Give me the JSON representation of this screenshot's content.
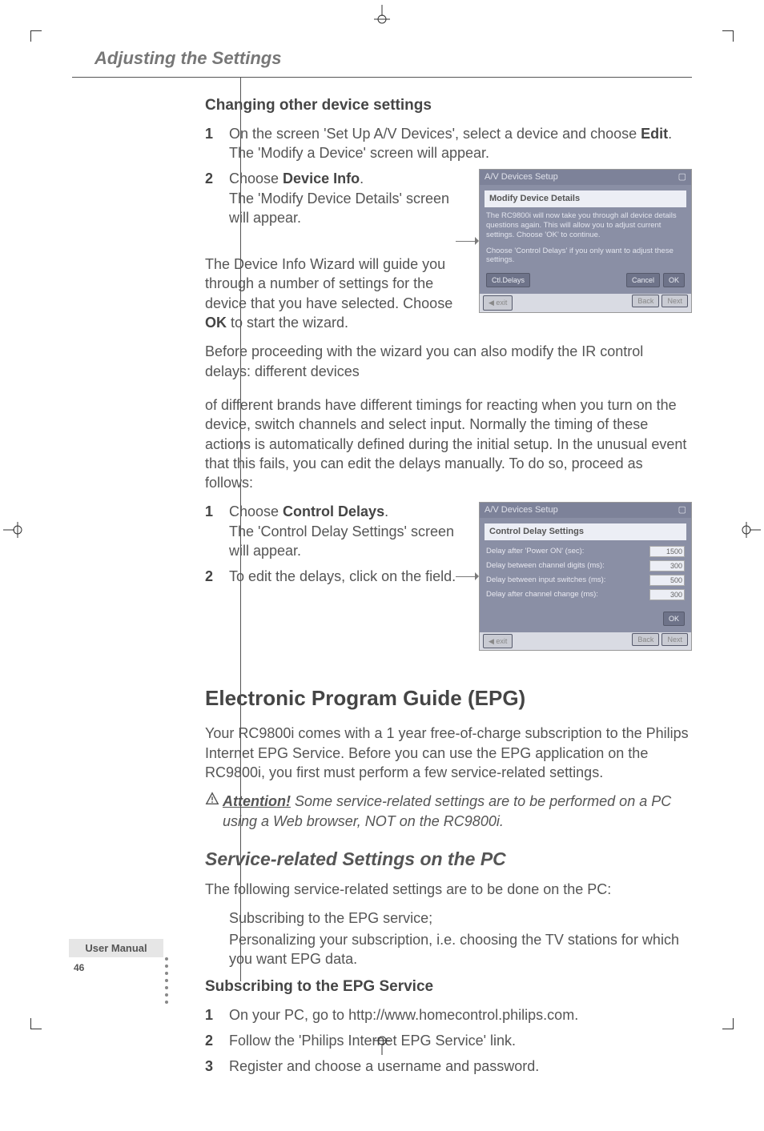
{
  "running_head": "Adjusting the Settings",
  "section1": {
    "title": "Changing other device settings",
    "step1_num": "1",
    "step1_a": "On the screen 'Set Up A/V Devices', select a device and choose ",
    "step1_bold": "Edit",
    "step1_b": ".",
    "step1_line2": "The 'Modify a Device' screen will appear.",
    "step2_num": "2",
    "step2_a": "Choose ",
    "step2_bold": "Device Info",
    "step2_b": ".",
    "step2_line2": "The 'Modify Device Details' screen will appear.",
    "para_wiz_a": "The Device Info Wizard will guide you through a number of settings for the device that you have selected. Choose ",
    "para_wiz_bold": "OK",
    "para_wiz_b": " to start the wizard.",
    "para_before": "Before proceeding with the wizard you can also modify the IR control delays: different devices",
    "para_brands": "of different brands have different timings for reacting when you turn on the device, switch channels and select input. Normally the timing of these actions is automatically defined during the initial setup. In the unusual event that this fails, you can edit the delays manually. To do so, proceed as follows:",
    "cd_step1_num": "1",
    "cd_step1_a": "Choose ",
    "cd_step1_bold": "Control Delays",
    "cd_step1_b": ".",
    "cd_step1_line2": "The 'Control Delay Settings' screen will appear.",
    "cd_step2_num": "2",
    "cd_step2_text": "To edit the delays, click on the field."
  },
  "screenshot1": {
    "titlebar": "A/V Devices Setup",
    "header": "Modify Device Details",
    "body1": "The RC9800i will now take you through all device details questions again. This will allow you to adjust current settings. Choose 'OK' to continue.",
    "body2": "Choose 'Control Delays' if you only want to adjust these settings.",
    "btn_delays": "Ctl.Delays",
    "btn_cancel": "Cancel",
    "btn_ok": "OK",
    "foot_left": "◀ exit",
    "foot_back": "Back",
    "foot_next": "Next"
  },
  "screenshot2": {
    "titlebar": "A/V Devices Setup",
    "header": "Control Delay Settings",
    "row1_label": "Delay after 'Power ON' (sec):",
    "row1_val": "1500",
    "row2_label": "Delay between channel digits (ms):",
    "row2_val": "300",
    "row3_label": "Delay between input switches (ms):",
    "row3_val": "500",
    "row4_label": "Delay after channel change (ms):",
    "row4_val": "300",
    "btn_ok": "OK",
    "foot_left": "◀ exit",
    "foot_back": "Back",
    "foot_next": "Next"
  },
  "epg": {
    "title": "Electronic Program Guide (EPG)",
    "intro": "Your RC9800i comes with a 1 year free-of-charge subscription to the Philips Internet EPG Service. Before you can use the EPG application on the RC9800i, you first must perform a few service-related settings.",
    "attn_label": "Attention!",
    "attn_text": " Some service-related settings are to be performed on a PC using a Web browser, NOT on the RC9800i.",
    "h3": "Service-related Settings on the PC",
    "para": "The following service-related settings are to be done on the PC:",
    "bullet1": "Subscribing to the EPG service;",
    "bullet2": "Personalizing your subscription, i.e. choosing the TV stations for which you want EPG data.",
    "h4": "Subscribing to the EPG Service",
    "s1_num": "1",
    "s1_text": "On your PC, go to http://www.homecontrol.philips.com.",
    "s2_num": "2",
    "s2_text": "Follow the 'Philips Internet EPG Service' link.",
    "s3_num": "3",
    "s3_text": "Register and choose a username and password."
  },
  "footer": {
    "user_manual": "User Manual",
    "page": "46"
  }
}
